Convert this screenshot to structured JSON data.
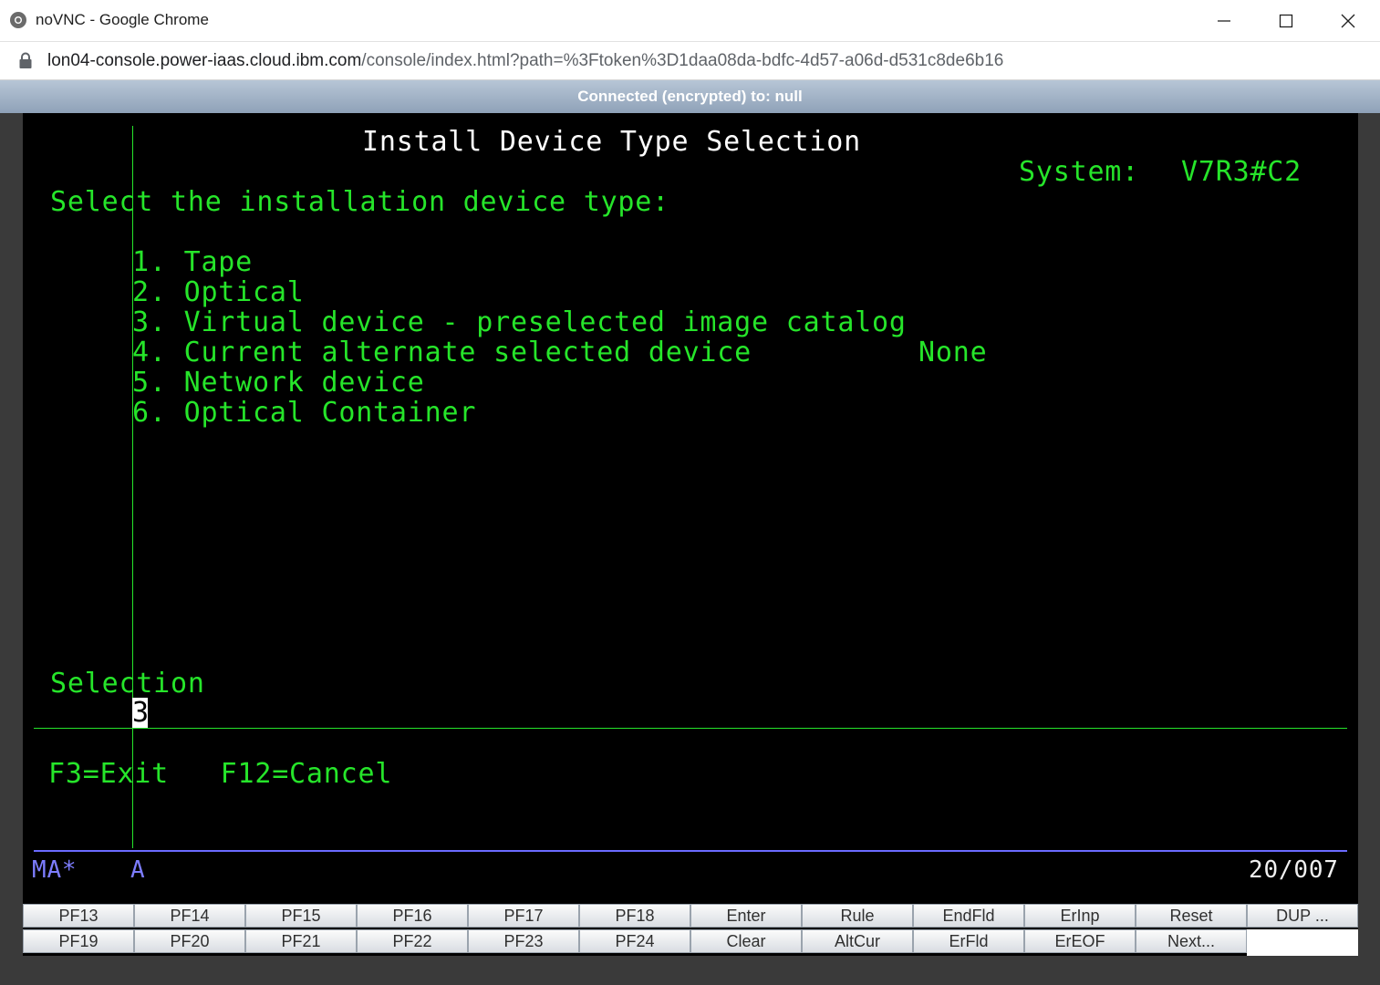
{
  "window": {
    "title": "noVNC - Google Chrome",
    "url_host": "lon04-console.power-iaas.cloud.ibm.com",
    "url_path": "/console/index.html?path=%3Ftoken%3D1daa08da-bdfc-4d57-a06d-d531c8de6b16"
  },
  "vnc": {
    "status": "Connected (encrypted) to: null"
  },
  "screen": {
    "title": "Install Device Type Selection",
    "system_label": "System:",
    "system_value": "V7R3#C2",
    "prompt": "Select the installation device type:",
    "options": [
      "1. Tape",
      "2. Optical",
      "3. Virtual device - preselected image catalog",
      "4. Current alternate selected device",
      "5. Network device",
      "6. Optical Container"
    ],
    "option4_value": "None",
    "selection_label": "Selection",
    "selection_value": "3",
    "fkeys": "F3=Exit   F12=Cancel",
    "oia_left": "MA*",
    "oia_mode": "A",
    "oia_position": "20/007"
  },
  "keypad": {
    "row1": [
      "PF13",
      "PF14",
      "PF15",
      "PF16",
      "PF17",
      "PF18",
      "Enter",
      "Rule",
      "EndFld",
      "ErInp",
      "Reset",
      "DUP ..."
    ],
    "row2": [
      "PF19",
      "PF20",
      "PF21",
      "PF22",
      "PF23",
      "PF24",
      "Clear",
      "AltCur",
      "ErFld",
      "ErEOF",
      "Next..."
    ]
  }
}
